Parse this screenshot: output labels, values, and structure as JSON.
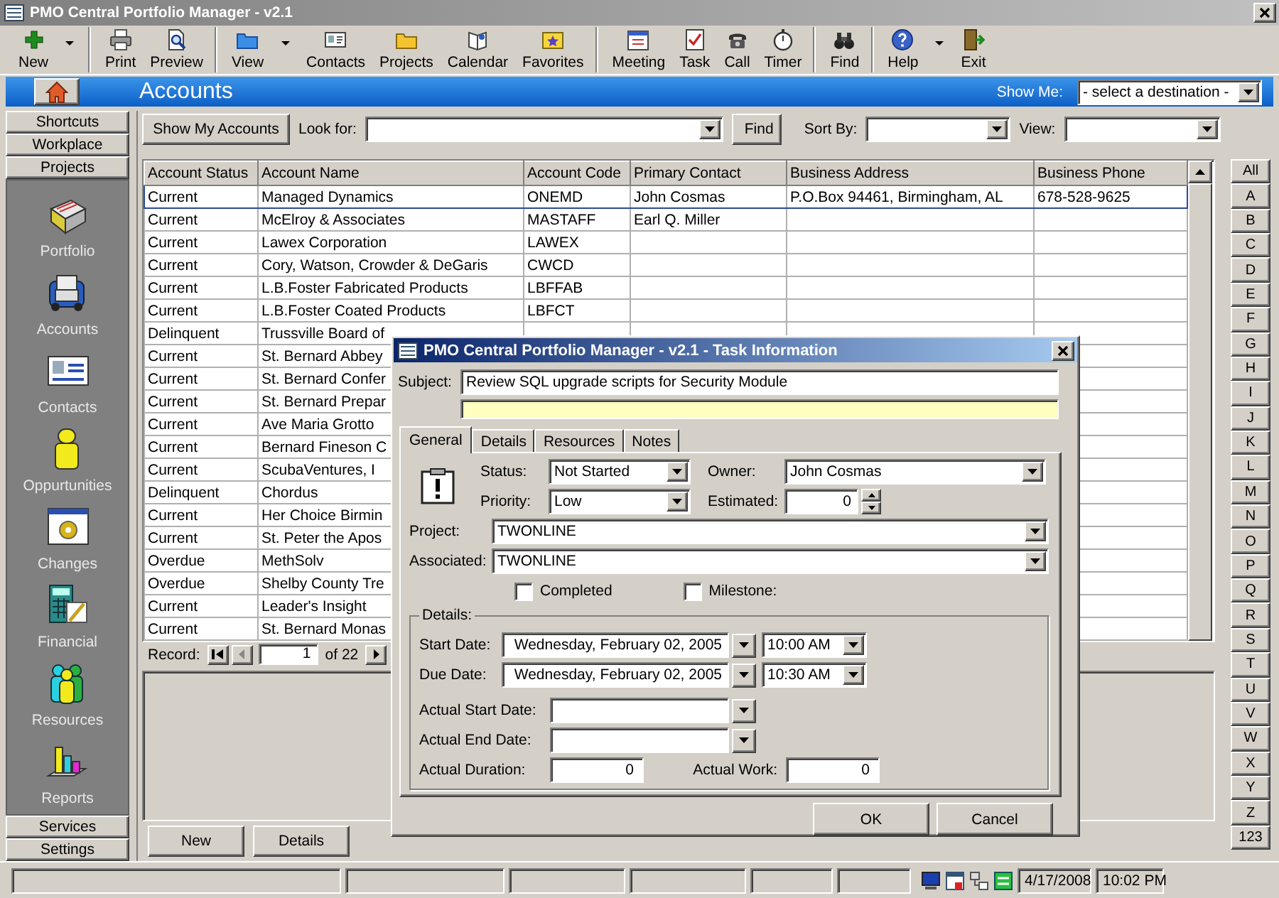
{
  "window": {
    "title": "PMO Central Portfolio Manager - v2.1"
  },
  "toolbar": [
    {
      "label": "New",
      "dropdown": true,
      "group_end": true
    },
    {
      "label": "Print",
      "dropdown": false,
      "group_end": false
    },
    {
      "label": "Preview",
      "dropdown": false,
      "group_end": true
    },
    {
      "label": "View",
      "dropdown": true,
      "group_end": false
    },
    {
      "label": "Contacts",
      "dropdown": false,
      "group_end": false
    },
    {
      "label": "Projects",
      "dropdown": false,
      "group_end": false
    },
    {
      "label": "Calendar",
      "dropdown": false,
      "group_end": false
    },
    {
      "label": "Favorites",
      "dropdown": false,
      "group_end": true
    },
    {
      "label": "Meeting",
      "dropdown": false,
      "group_end": false
    },
    {
      "label": "Task",
      "dropdown": false,
      "group_end": false
    },
    {
      "label": "Call",
      "dropdown": false,
      "group_end": false
    },
    {
      "label": "Timer",
      "dropdown": false,
      "group_end": true
    },
    {
      "label": "Find",
      "dropdown": false,
      "group_end": true
    },
    {
      "label": "Help",
      "dropdown": true,
      "group_end": false
    },
    {
      "label": "Exit",
      "dropdown": false,
      "group_end": false
    }
  ],
  "header_bar": {
    "title": "Accounts",
    "show_me_label": "Show Me:",
    "destination": "- select a destination -"
  },
  "sidebar": {
    "top_buttons": [
      "Shortcuts",
      "Workplace",
      "Projects"
    ],
    "items": [
      "Portfolio",
      "Accounts",
      "Contacts",
      "Oppurtunities",
      "Changes",
      "Financial",
      "Resources",
      "Reports"
    ],
    "bottom_buttons": [
      "Services",
      "Settings"
    ]
  },
  "filter": {
    "show_mine": "Show My Accounts",
    "look_for_label": "Look for:",
    "find": "Find",
    "sort_by_label": "Sort By:",
    "view_label": "View:"
  },
  "table": {
    "columns": [
      "Account Status",
      "Account Name",
      "Account Code",
      "Primary Contact",
      "Business Address",
      "Business Phone"
    ],
    "rows": [
      {
        "cells": [
          "Current",
          "Managed Dynamics",
          "ONEMD",
          "John Cosmas",
          "P.O.Box 94461, Birmingham, AL",
          "678-528-9625"
        ],
        "selected": true
      },
      {
        "cells": [
          "Current",
          "McElroy & Associates",
          "MASTAFF",
          "Earl Q. Miller"
        ],
        "selected": false
      },
      {
        "cells": [
          "Current",
          "Lawex Corporation",
          "LAWEX"
        ],
        "selected": false
      },
      {
        "cells": [
          "Current",
          "Cory, Watson, Crowder & DeGaris",
          "CWCD"
        ],
        "selected": false
      },
      {
        "cells": [
          "Current",
          "L.B.Foster Fabricated Products",
          "LBFFAB"
        ],
        "selected": false
      },
      {
        "cells": [
          "Current",
          "L.B.Foster Coated Products",
          "LBFCT"
        ],
        "selected": false
      },
      {
        "cells": [
          "Delinquent",
          "Trussville Board of"
        ],
        "selected": false
      },
      {
        "cells": [
          "Current",
          "St. Bernard Abbey"
        ],
        "selected": false
      },
      {
        "cells": [
          "Current",
          "St. Bernard Confer"
        ],
        "selected": false
      },
      {
        "cells": [
          "Current",
          "St. Bernard Prepar"
        ],
        "selected": false
      },
      {
        "cells": [
          "Current",
          "Ave Maria Grotto"
        ],
        "selected": false
      },
      {
        "cells": [
          "Current",
          "Bernard Fineson C"
        ],
        "selected": false
      },
      {
        "cells": [
          "Current",
          "ScubaVentures, I"
        ],
        "selected": false
      },
      {
        "cells": [
          "Delinquent",
          "Chordus"
        ],
        "selected": false
      },
      {
        "cells": [
          "Current",
          "Her Choice Birmin"
        ],
        "selected": false
      },
      {
        "cells": [
          "Current",
          "St. Peter the Apos"
        ],
        "selected": false
      },
      {
        "cells": [
          "Overdue",
          "MethSolv"
        ],
        "selected": false
      },
      {
        "cells": [
          "Overdue",
          "Shelby County Tre"
        ],
        "selected": false
      },
      {
        "cells": [
          "Current",
          "Leader's Insight"
        ],
        "selected": false
      },
      {
        "cells": [
          "Current",
          "St. Bernard Monas"
        ],
        "selected": false
      }
    ]
  },
  "record_nav": {
    "label": "Record:",
    "current": "1",
    "total": "of 22"
  },
  "actions": [
    "New",
    "Details"
  ],
  "letters": [
    "All",
    "A",
    "B",
    "C",
    "D",
    "E",
    "F",
    "G",
    "H",
    "I",
    "J",
    "K",
    "L",
    "M",
    "N",
    "O",
    "P",
    "Q",
    "R",
    "S",
    "T",
    "U",
    "V",
    "W",
    "X",
    "Y",
    "Z",
    "123"
  ],
  "status_bar": {
    "date": "4/17/2008",
    "time": "10:02 PM"
  },
  "dialog": {
    "title": "PMO Central Portfolio Manager - v2.1 - Task Information",
    "subject_label": "Subject:",
    "subject": "Review SQL upgrade scripts for Security Module",
    "tabs": [
      {
        "label": "General",
        "selected": true
      },
      {
        "label": "Details",
        "selected": false
      },
      {
        "label": "Resources",
        "selected": false
      },
      {
        "label": "Notes",
        "selected": false
      }
    ],
    "status": {
      "label": "Status:",
      "value": "Not Started"
    },
    "owner": {
      "label": "Owner:",
      "value": "John Cosmas"
    },
    "priority": {
      "label": "Priority:",
      "value": "Low"
    },
    "estimated": {
      "label": "Estimated:",
      "value": "0"
    },
    "project": {
      "label": "Project:",
      "value": "TWONLINE"
    },
    "associated": {
      "label": "Associated:",
      "value": "TWONLINE"
    },
    "completed": {
      "label": "Completed",
      "checked": false
    },
    "milestone": {
      "label": "Milestone:",
      "checked": false
    },
    "details": {
      "legend": "Details:",
      "start_date": {
        "label": "Start Date:",
        "date": "Wednesday, February 02, 2005",
        "time": "10:00 AM"
      },
      "due_date": {
        "label": "Due Date:",
        "date": "Wednesday, February 02, 2005",
        "time": "10:30 AM"
      },
      "actual_start": {
        "label": "Actual Start Date:"
      },
      "actual_end": {
        "label": "Actual End Date:"
      },
      "actual_duration": {
        "label": "Actual Duration:",
        "value": "0"
      },
      "actual_work": {
        "label": "Actual Work:",
        "value": "0"
      }
    },
    "buttons": [
      "OK",
      "Cancel"
    ]
  }
}
